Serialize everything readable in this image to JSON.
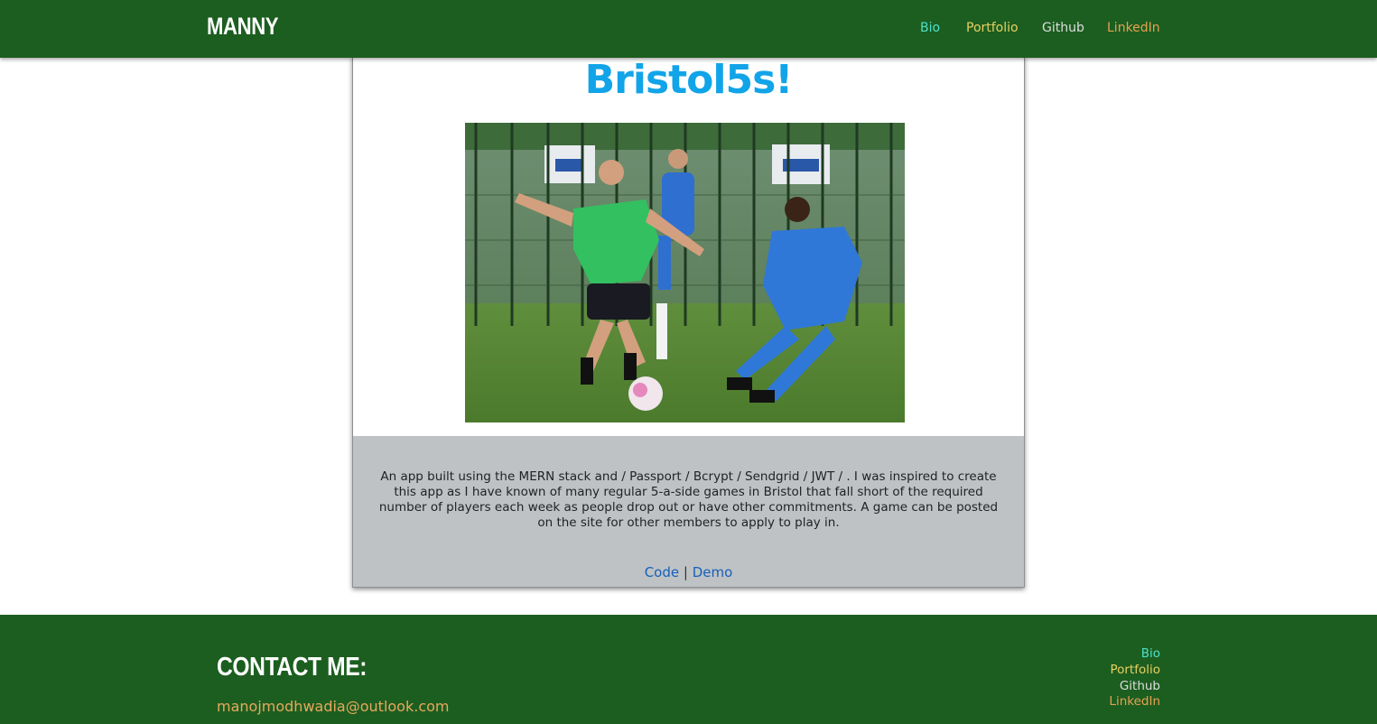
{
  "navbar": {
    "brand": "MANNY",
    "links": [
      {
        "label": "Bio",
        "color": "#4de0c8"
      },
      {
        "label": "Portfolio",
        "color": "#e8d060"
      },
      {
        "label": "Github",
        "color": "#dddddd"
      },
      {
        "label": "LinkedIn",
        "color": "#e8a050"
      }
    ]
  },
  "project": {
    "title": "Bristol5s!",
    "image_alt": "Two players contesting a football on a 5-a-side pitch",
    "description": "An app built using the MERN stack and / Passport / Bcrypt / Sendgrid / JWT / . I was inspired to create this app as I have known of many regular 5-a-side games in Bristol that fall short of the required number of players each week as people drop out or have other commitments. A game can be posted on the site for other members to apply to play in.",
    "code_label": "Code",
    "separator": "|",
    "demo_label": "Demo"
  },
  "footer": {
    "title": "CONTACT ME:",
    "email": "manojmodhwadia@outlook.com",
    "links": [
      {
        "label": "Bio",
        "color": "#4de0c8"
      },
      {
        "label": "Portfolio",
        "color": "#e8d060"
      },
      {
        "label": "Github",
        "color": "#dddddd"
      },
      {
        "label": "LinkedIn",
        "color": "#e8a050"
      }
    ]
  },
  "colors": {
    "nav_bg": "#1c5e20",
    "title_blue": "#12a4e8",
    "info_bg": "#bec2c5",
    "link_blue": "#1560b8"
  }
}
